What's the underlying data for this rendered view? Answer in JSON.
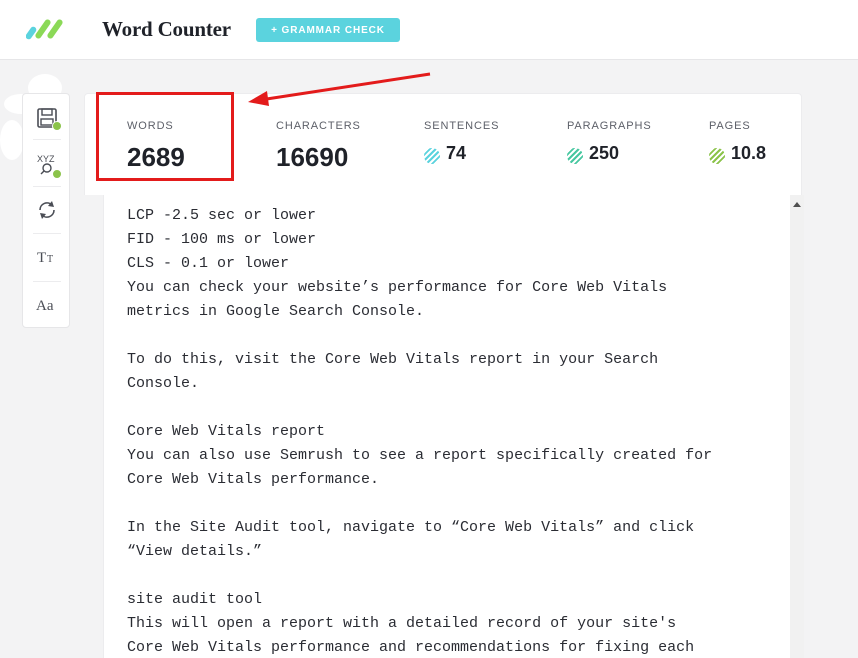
{
  "header": {
    "title": "Word Counter",
    "grammar_button": "+ GRAMMAR CHECK",
    "logo_icon": "word-counter-logo",
    "logo_colors": [
      "#8bd957",
      "#5bd3de"
    ]
  },
  "toolbar": {
    "items": [
      {
        "name": "save-icon",
        "badge": true
      },
      {
        "name": "spellcheck-icon",
        "label": "XYZ",
        "badge": true
      },
      {
        "name": "refresh-icon"
      },
      {
        "name": "text-case-icon",
        "label": "TT"
      },
      {
        "name": "font-icon",
        "label": "Aa"
      }
    ]
  },
  "stats": {
    "words": {
      "label": "WORDS",
      "value": "2689"
    },
    "characters": {
      "label": "CHARACTERS",
      "value": "16690"
    },
    "sentences": {
      "label": "SENTENCES",
      "value": "74",
      "color": "#5bd3de"
    },
    "paragraphs": {
      "label": "PARAGRAPHS",
      "value": "250",
      "color": "#47c7a0"
    },
    "pages": {
      "label": "PAGES",
      "value": "10.8",
      "color": "#8bc34a"
    }
  },
  "annotation": {
    "color": "#e31b1b"
  },
  "editor": {
    "lines": [
      "LCP -2.5 sec or lower",
      "FID - 100 ms or lower",
      "CLS - 0.1 or lower",
      "You can check your website’s performance for Core Web Vitals",
      "metrics in Google Search Console.",
      "",
      "To do this, visit the Core Web Vitals report in your Search",
      "Console.",
      "",
      "Core Web Vitals report",
      "You can also use Semrush to see a report specifically created for",
      "Core Web Vitals performance.",
      "",
      "In the Site Audit tool, navigate to “Core Web Vitals” and click",
      "“View details.”",
      "",
      "site audit tool",
      "This will open a report with a detailed record of your site's",
      "Core Web Vitals performance and recommendations for fixing each"
    ]
  }
}
